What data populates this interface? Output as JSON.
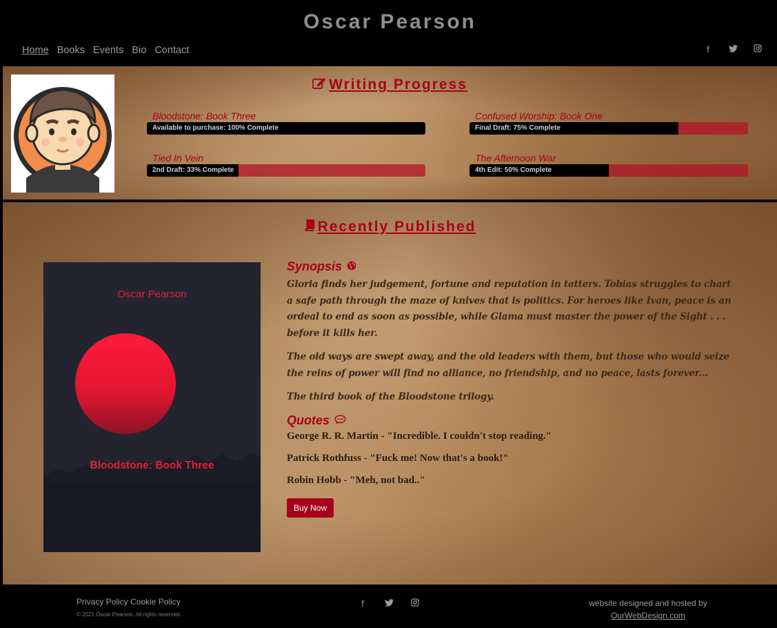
{
  "header": {
    "site_title": "Oscar Pearson",
    "nav": [
      "Home",
      "Books",
      "Events",
      "Bio",
      "Contact"
    ],
    "social_icons": [
      "facebook-icon",
      "twitter-icon",
      "instagram-icon"
    ]
  },
  "progress": {
    "heading": "Writing Progress",
    "items": [
      {
        "title": "Bloodstone: Book Three",
        "label": "Available to purchase: 100% Complete",
        "percent": 100
      },
      {
        "title": "Confused Worship: Book One",
        "label": "Final Draft: 75% Complete",
        "percent": 75
      },
      {
        "title": "Tied In Vein",
        "label": "2nd Draft: 33% Complete",
        "percent": 33
      },
      {
        "title": "The Afternoon War",
        "label": "4th Edit: 50% Complete",
        "percent": 50
      }
    ]
  },
  "published": {
    "heading": "Recently Published",
    "cover": {
      "author": "Oscar Pearson",
      "title": "Bloodstone: Book Three"
    },
    "synopsis_heading": "Synopsis",
    "synopsis": [
      "Gloria finds her judgement, fortune and reputation in tatters. Tobias struggles to chart a safe path through the maze of knives that is politics. For heroes like Ivan, peace is an ordeal to end as soon as possible, while Glama must master the power of the Sight . . . before it kills her.",
      "The old ways are swept away, and the old leaders with them, but those who would seize the reins of power will find no alliance, no friendship, and no peace, lasts forever...",
      "The third book of the Bloodstone trilogy."
    ],
    "quotes_heading": "Quotes",
    "quotes": [
      "George R. R. Martin - \"Incredible. I couldn't stop reading.\"",
      "Patrick Rothfuss - \"Fuck me! Now that's a book!\"",
      "Robin Hobb - \"Meh, not bad..\""
    ],
    "buy_label": "Buy Now"
  },
  "footer": {
    "privacy": "Privacy Policy",
    "cookie": "Cookie Policy",
    "copyright": "© 2021 Oscar Pearson. All rights reserved.",
    "credit": "website designed and hosted by",
    "credit_link": "OurWebDesign.com"
  },
  "colors": {
    "accent": "#a8001b",
    "header_bg": "#000000",
    "bar_bg": "#b21428"
  }
}
